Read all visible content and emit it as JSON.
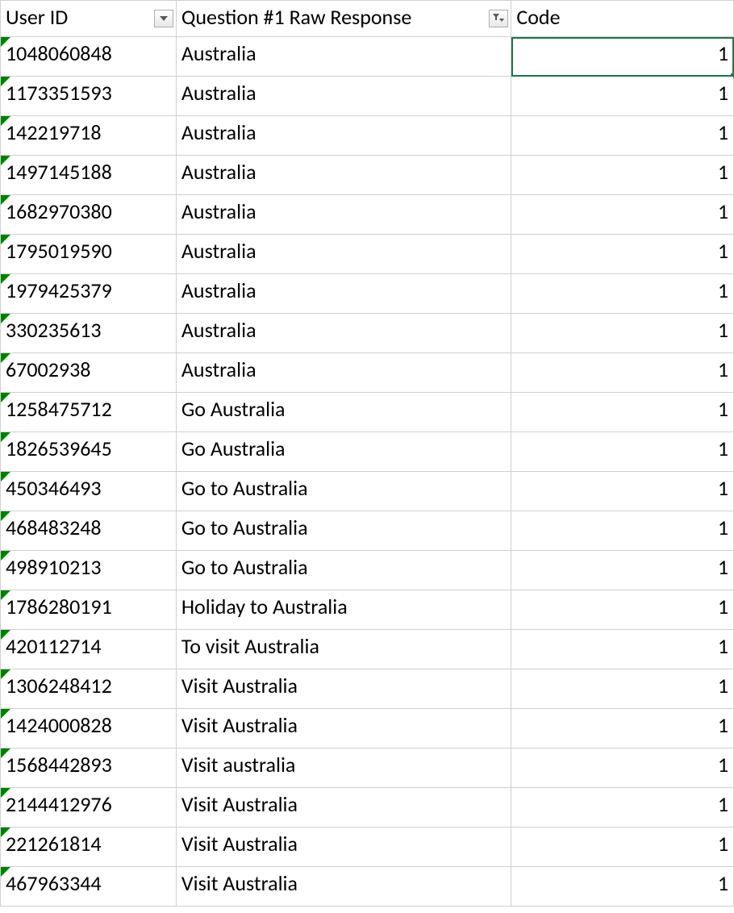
{
  "headers": {
    "col_a": "User ID",
    "col_b": "Question #1 Raw Response",
    "col_c": "Code"
  },
  "rows": [
    {
      "user_id": "1048060848",
      "response": "Australia",
      "code": "1"
    },
    {
      "user_id": "1173351593",
      "response": "Australia",
      "code": "1"
    },
    {
      "user_id": "142219718",
      "response": "Australia",
      "code": "1"
    },
    {
      "user_id": "1497145188",
      "response": "Australia",
      "code": "1"
    },
    {
      "user_id": "1682970380",
      "response": "Australia",
      "code": "1"
    },
    {
      "user_id": "1795019590",
      "response": "Australia",
      "code": "1"
    },
    {
      "user_id": "1979425379",
      "response": "Australia",
      "code": "1"
    },
    {
      "user_id": "330235613",
      "response": "Australia",
      "code": "1"
    },
    {
      "user_id": "67002938",
      "response": "Australia",
      "code": "1"
    },
    {
      "user_id": "1258475712",
      "response": "Go Australia",
      "code": "1"
    },
    {
      "user_id": "1826539645",
      "response": "Go Australia",
      "code": "1"
    },
    {
      "user_id": "450346493",
      "response": "Go to Australia",
      "code": "1"
    },
    {
      "user_id": "468483248",
      "response": "Go to Australia",
      "code": "1"
    },
    {
      "user_id": "498910213",
      "response": "Go to Australia",
      "code": "1"
    },
    {
      "user_id": "1786280191",
      "response": "Holiday to Australia",
      "code": "1"
    },
    {
      "user_id": "420112714",
      "response": "To visit Australia",
      "code": "1"
    },
    {
      "user_id": "1306248412",
      "response": "Visit Australia",
      "code": "1"
    },
    {
      "user_id": "1424000828",
      "response": "Visit Australia",
      "code": "1"
    },
    {
      "user_id": "1568442893",
      "response": "Visit australia",
      "code": "1"
    },
    {
      "user_id": "2144412976",
      "response": "Visit Australia",
      "code": "1"
    },
    {
      "user_id": "221261814",
      "response": "Visit Australia",
      "code": "1"
    },
    {
      "user_id": "467963344",
      "response": "Visit Australia",
      "code": "1"
    }
  ],
  "selected_cell_row_index": 0
}
